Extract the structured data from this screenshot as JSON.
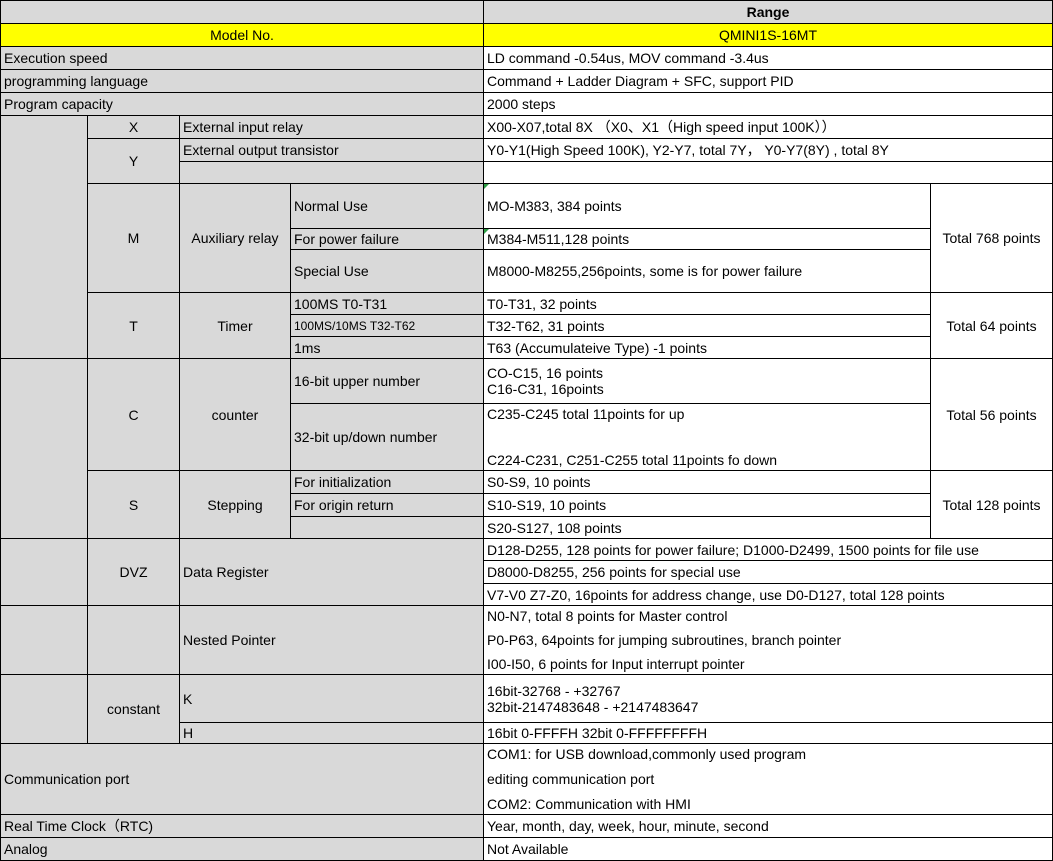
{
  "header": {
    "range": "Range",
    "model_label": "Model No.",
    "model_value": "QMINI1S-16MT"
  },
  "general": [
    {
      "label": "Execution speed",
      "value": "LD command -0.54us, MOV command -3.4us"
    },
    {
      "label": "programming language",
      "value": "Command + Ladder Diagram + SFC, support PID"
    },
    {
      "label": "Program capacity",
      "value": "2000 steps"
    }
  ],
  "x": {
    "code": "X",
    "name": "External input relay",
    "value": "X00-X07,total 8X （X0、X1（High speed input 100K））"
  },
  "y": {
    "code": "Y",
    "name": "External output transistor",
    "value": "Y0-Y1(High Speed 100K), Y2-Y7, total 7Y， Y0-Y7(8Y) , total 8Y"
  },
  "m": {
    "code": "M",
    "name": "Auxiliary relay",
    "total": "Total 768 points",
    "rows": [
      {
        "label": "Normal Use",
        "value": "MO-M383, 384 points"
      },
      {
        "label": "For power failure",
        "value": "M384-M511,128 points"
      },
      {
        "label": "Special Use",
        "value": "M8000-M8255,256points, some is for power failure"
      }
    ]
  },
  "t": {
    "code": "T",
    "name": "Timer",
    "total": "Total 64 points",
    "rows": [
      {
        "label": "100MS T0-T31",
        "value": "T0-T31, 32 points"
      },
      {
        "label": "100MS/10MS T32-T62",
        "value": "T32-T62, 31 points"
      },
      {
        "label": "1ms",
        "value": "T63 (Accumulateive Type) -1 points"
      }
    ]
  },
  "c": {
    "code": "C",
    "name": "counter",
    "total": "Total 56 points",
    "up_label": "16-bit upper number",
    "up_values": [
      "CO-C15, 16 points",
      "C16-C31, 16points"
    ],
    "updown_label": "32-bit up/down number",
    "updown_values": [
      "C235-C245    total 11points for up",
      "C224-C231,  C251-C255  total 11points fo down"
    ]
  },
  "s": {
    "code": "S",
    "name": "Stepping",
    "total": "Total 128 points",
    "rows": [
      {
        "label": "For initialization",
        "value": "S0-S9, 10 points"
      },
      {
        "label": "For origin return",
        "value": "S10-S19, 10 points"
      },
      {
        "label": "",
        "value": "S20-S127, 108 points"
      }
    ]
  },
  "dvz": {
    "code": "DVZ",
    "name": "Data Register",
    "values": [
      "D128-D255, 128 points for power failure; D1000-D2499, 1500 points for file use",
      "D8000-D8255, 256 points for special use",
      "V7-V0 Z7-Z0, 16points for address change, use D0-D127, total 128 points"
    ]
  },
  "pointer": {
    "name": "Nested Pointer",
    "values": [
      "N0-N7, total 8 points for Master control",
      "P0-P63, 64points for jumping subroutines, branch pointer",
      "I00-I50, 6 points for Input interrupt pointer"
    ]
  },
  "constant": {
    "name": "constant",
    "k_label": "K",
    "k_values": [
      "16bit-32768 - +32767",
      "32bit-2147483648 - +2147483647"
    ],
    "h_label": "H",
    "h_value": "16bit 0-FFFFH 32bit 0-FFFFFFFFH"
  },
  "comm": {
    "label": "Communication port",
    "values": [
      "COM1:  for USB download,commonly used program",
      "editing communication port",
      "COM2:  Communication with HMI"
    ]
  },
  "rtc": {
    "label": "Real Time Clock（RTC)",
    "value": "Year, month, day, week, hour, minute, second"
  },
  "analog": {
    "label": "Analog",
    "value": "Not Available"
  }
}
